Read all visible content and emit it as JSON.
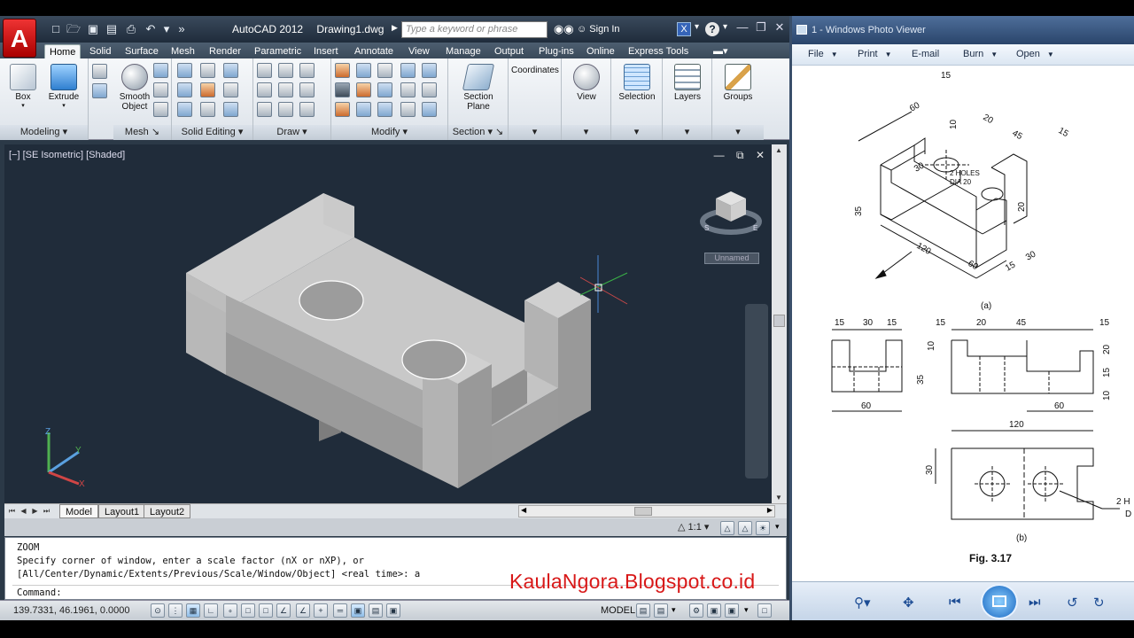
{
  "autocad": {
    "app_button": "A",
    "title": "AutoCAD 2012",
    "filename": "Drawing1.dwg",
    "search_placeholder": "Type a keyword or phrase",
    "sign_in": "Sign In",
    "ribbon_tabs": [
      "Home",
      "Solid",
      "Surface",
      "Mesh",
      "Render",
      "Parametric",
      "Insert",
      "Annotate",
      "View",
      "Manage",
      "Output",
      "Plug-ins",
      "Online",
      "Express Tools"
    ],
    "active_tab": "Home",
    "groups": {
      "modeling": "Modeling",
      "mesh": "Mesh",
      "solid_editing": "Solid Editing",
      "draw": "Draw",
      "modify": "Modify",
      "section": "Section"
    },
    "buttons": {
      "box": "Box",
      "extrude": "Extrude",
      "smooth_object_1": "Smooth",
      "smooth_object_2": "Object",
      "section_plane_1": "Section",
      "section_plane_2": "Plane",
      "coordinates": "Coordinates",
      "view": "View",
      "selection": "Selection",
      "layers": "Layers",
      "groups": "Groups"
    },
    "viewport_label": "[−] [SE Isometric] [Shaded]",
    "viewcube_label": "Unnamed",
    "layout_tabs": [
      "Model",
      "Layout1",
      "Layout2"
    ],
    "annotation_scale": "1:1",
    "command_lines": [
      "ZOOM",
      "Specify corner of window, enter a scale factor (nX or nXP), or",
      "[All/Center/Dynamic/Extents/Previous/Scale/Window/Object] <real time>: a"
    ],
    "command_prompt": "Command:",
    "coordinates": "139.7331, 46.1961, 0.0000",
    "model_button": "MODEL",
    "watermark": "KaulaNgora.Blogspot.co.id"
  },
  "photo_viewer": {
    "title": "1 - Windows Photo Viewer",
    "menu": [
      "File",
      "Print",
      "E-mail",
      "Burn",
      "Open"
    ],
    "drawing": {
      "top_dims": {
        "d60": "60",
        "d15a": "15",
        "d20": "20",
        "d45": "45",
        "d15b": "15",
        "d35": "35",
        "d30": "30",
        "d10": "10",
        "d120": "120",
        "d60b": "60",
        "d15c": "15",
        "d30b": "30",
        "d20b": "20",
        "holes_1": "2 HOLES",
        "holes_2": "DIA 20",
        "caption_a": "(a)"
      },
      "side_dims": {
        "s15a": "15",
        "s30": "30",
        "s15b": "15",
        "s60": "60"
      },
      "front_dims": {
        "f15a": "15",
        "f20": "20",
        "f45": "45",
        "f15b": "15",
        "f10": "10",
        "f35": "35",
        "f20b": "20",
        "f15c": "15",
        "f10b": "10",
        "f60": "60",
        "f120": "120"
      },
      "plan_dims": {
        "p30": "30",
        "callout_1": "2 H",
        "callout_2": "D"
      },
      "caption_b": "(b)",
      "figure": "Fig. 3.17"
    }
  }
}
